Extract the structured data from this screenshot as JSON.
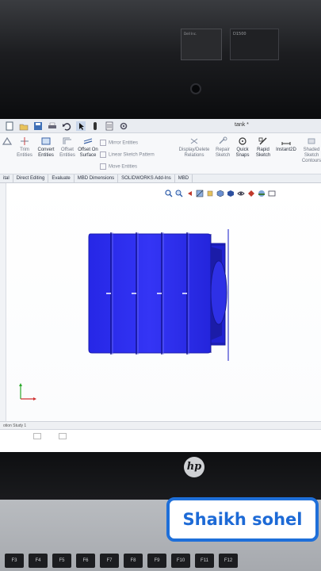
{
  "bezel": {
    "sticker_left": "Dell Inc.",
    "sticker_right": "D1500"
  },
  "app": {
    "document_title": "tank *"
  },
  "ribbon": {
    "commands": [
      {
        "label": "Trim Entities",
        "icon": "trim-icon"
      },
      {
        "label": "Convert Entities",
        "icon": "convert-icon"
      },
      {
        "label": "Offset Entities",
        "icon": "offset-icon"
      },
      {
        "label": "Offset On Surface",
        "icon": "offset-surface-icon"
      },
      {
        "label": "Display/Delete Relations",
        "icon": "relations-icon"
      },
      {
        "label": "Repair Sketch",
        "icon": "repair-icon"
      },
      {
        "label": "Quick Snaps",
        "icon": "snap-icon"
      },
      {
        "label": "Rapid Sketch",
        "icon": "rapid-sketch-icon"
      },
      {
        "label": "Instant2D",
        "icon": "instant2d-icon"
      },
      {
        "label": "Shaded Sketch Contours",
        "icon": "shaded-icon"
      }
    ],
    "small_commands": [
      "Mirror Entities",
      "Linear Sketch Pattern",
      "Move Entities"
    ]
  },
  "tabs": [
    "ital",
    "Direct Editing",
    "Evaluate",
    "MBD Dimensions",
    "SOLIDWORKS Add-Ins",
    "MBD"
  ],
  "status": {
    "bottom_tab": "otion Study 1"
  },
  "keyboard": {
    "keys": [
      "F3",
      "F4",
      "F5",
      "F6",
      "F7",
      "F8",
      "F9",
      "F10",
      "F11",
      "F12"
    ]
  },
  "watermark": {
    "text": "Shaikh sohel"
  },
  "colors": {
    "model_blue": "#2b2cf0",
    "model_dark": "#1b1ca8",
    "watermark_border": "#1e6fd9"
  }
}
